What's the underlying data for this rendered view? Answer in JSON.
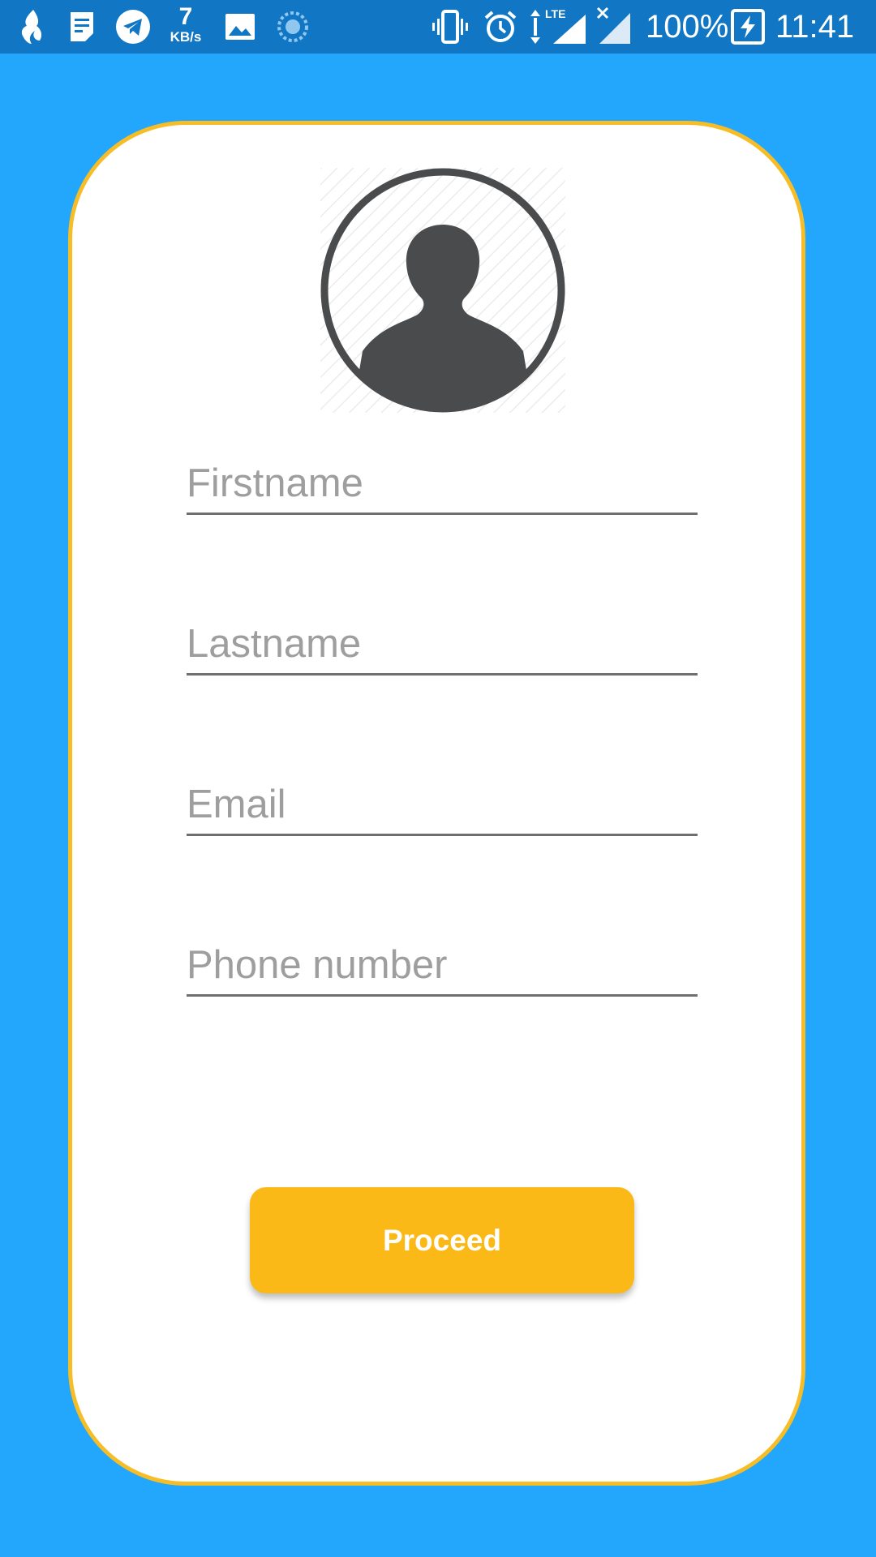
{
  "status_bar": {
    "left_icons": [
      "flame-app-icon",
      "notes-icon",
      "telegram-icon",
      "gallery-icon",
      "sync-icon"
    ],
    "speed_value": "7",
    "speed_unit": "KB/s",
    "right_icons": [
      "vibrate-icon",
      "alarm-icon",
      "lte-signal-icon",
      "no-sim-signal-icon",
      "battery-charging-icon"
    ],
    "network_label": "LTE",
    "battery_percent": "100%",
    "time": "11:41"
  },
  "form": {
    "avatar_icon": "user-avatar-icon",
    "fields": [
      {
        "name": "firstname",
        "placeholder": "Firstname",
        "value": ""
      },
      {
        "name": "lastname",
        "placeholder": "Lastname",
        "value": ""
      },
      {
        "name": "email",
        "placeholder": "Email",
        "value": ""
      },
      {
        "name": "phone",
        "placeholder": "Phone number",
        "value": ""
      }
    ],
    "proceed_label": "Proceed"
  },
  "colors": {
    "background": "#22a7fc",
    "status_bar": "#1176c4",
    "card_border": "#f6bd26",
    "button": "#fbb918",
    "avatar": "#4a4b4d"
  }
}
